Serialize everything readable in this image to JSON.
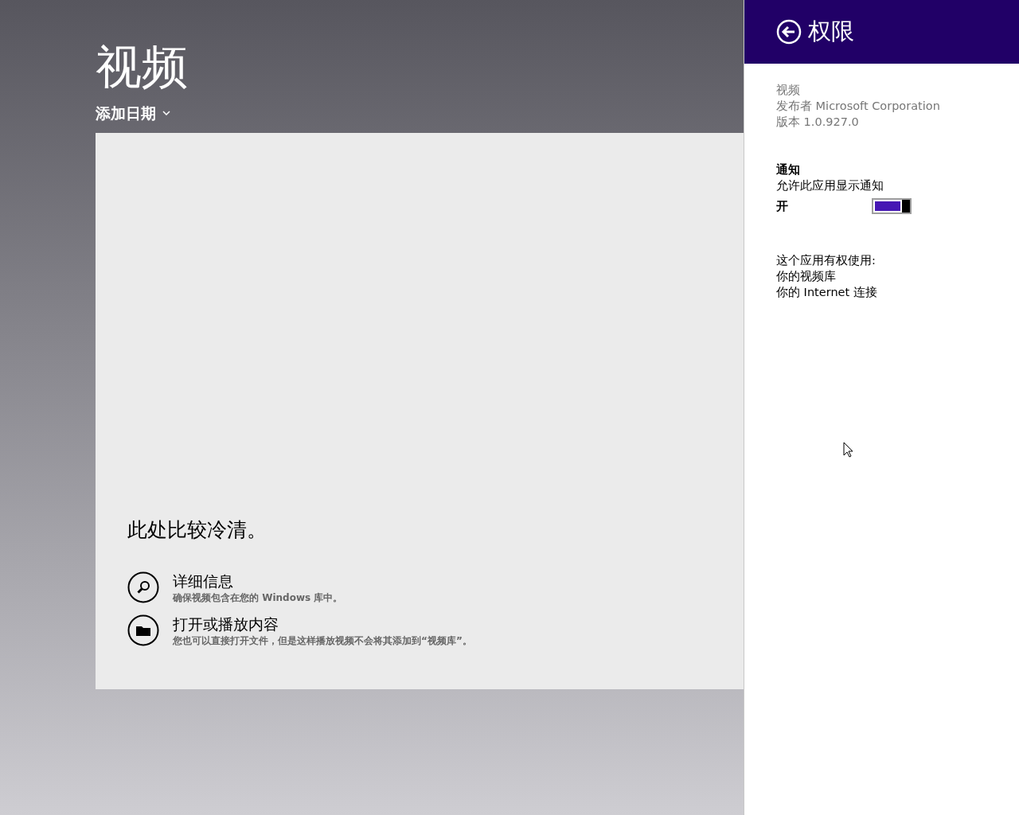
{
  "app": {
    "title": "视频",
    "sort": "添加日期"
  },
  "empty_state": {
    "message": "此处比较冷清。",
    "actions": [
      {
        "kind": "search",
        "title": "详细信息",
        "description": "确保视频包含在您的 Windows 库中。"
      },
      {
        "kind": "folder",
        "title": "打开或播放内容",
        "description": "您也可以直接打开文件，但是这样播放视频不会将其添加到“视频库”。"
      }
    ]
  },
  "permissions_pane": {
    "title": "权限",
    "app_name": "视频",
    "publisher": "发布者 Microsoft Corporation",
    "version": "版本 1.0.927.0",
    "notifications": {
      "heading": "通知",
      "description": "允许此应用显示通知",
      "state_label": "开",
      "on": true
    },
    "capabilities": {
      "heading": "这个应用有权使用:",
      "items": [
        "你的视频库",
        "你的 Internet 连接"
      ]
    }
  }
}
